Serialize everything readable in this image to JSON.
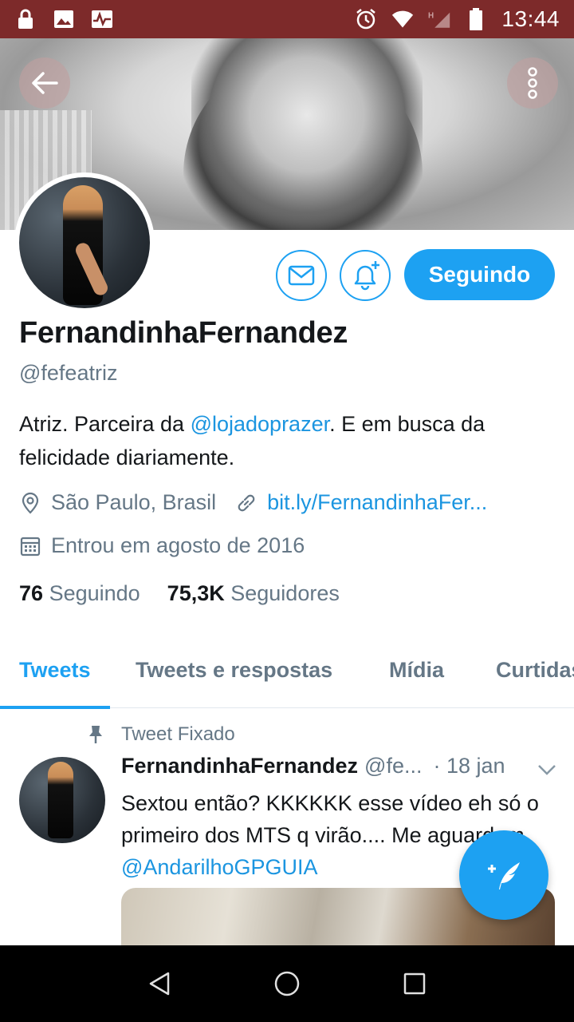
{
  "status_bar": {
    "time": "13:44",
    "left_icons": [
      "lock-icon",
      "image-icon",
      "activity-icon"
    ],
    "right_icons": [
      "alarm-icon",
      "wifi-icon",
      "signal-h-icon",
      "battery-icon"
    ],
    "background": "#7d2a2a"
  },
  "profile": {
    "display_name": "FernandinhaFernandez",
    "handle": "@fefeatriz",
    "bio_pre": "Atriz. Parceira da ",
    "bio_mention": "@lojadoprazer",
    "bio_post": ". E em busca da felicidade diariamente.",
    "location": "São Paulo, Brasil",
    "website": "bit.ly/FernandinhaFer...",
    "joined": "Entrou em agosto de 2016",
    "following_count": "76",
    "following_label": "Seguindo",
    "followers_count": "75,3K",
    "followers_label": "Seguidores",
    "follow_button_label": "Seguindo"
  },
  "tabs": [
    {
      "label": "Tweets",
      "active": true
    },
    {
      "label": "Tweets e respostas",
      "active": false
    },
    {
      "label": "Mídia",
      "active": false
    },
    {
      "label": "Curtidas",
      "active": false
    }
  ],
  "tweet": {
    "pinned_label": "Tweet Fixado",
    "author_name": "FernandinhaFernandez",
    "author_handle": "@fe...",
    "date": "· 18 jan",
    "text": "Sextou então? KKKKKK esse vídeo eh só o primeiro dos MTS q virão.... Me aguardem ",
    "mention": "@AndarilhoGPGUIA"
  },
  "colors": {
    "accent": "#1da1f2",
    "link": "#1b95e0",
    "muted": "#657786"
  }
}
